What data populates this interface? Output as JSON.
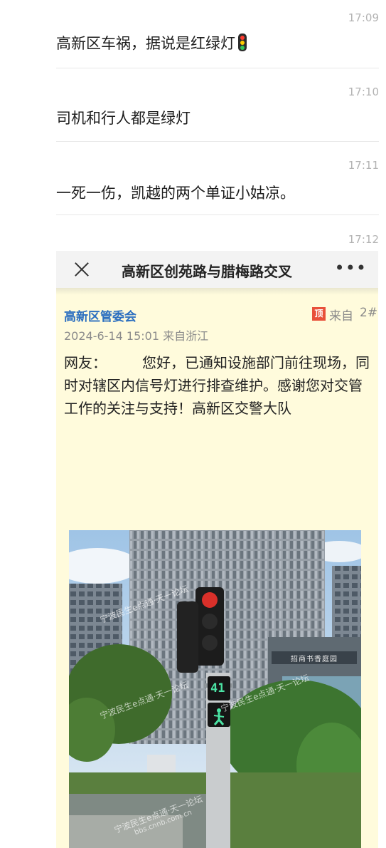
{
  "messages": [
    {
      "time": "17:09",
      "text": "高新区车祸，据说是红绿灯"
    },
    {
      "time": "17:10",
      "text": "司机和行人都是绿灯"
    },
    {
      "time": "17:11",
      "text": "一死一伤，凯越的两个单证小姑凉。"
    }
  ],
  "last_time": "17:12",
  "card": {
    "title": "高新区创苑路与腊梅路交叉",
    "poster": "高新区管委会",
    "badge": "顶",
    "source_label": "来自",
    "floor": "2#",
    "meta": "2024-6-14 15:01 来自浙江",
    "body": "网友：　　　您好，已通知设施部门前往现场，同时对辖区内信号灯进行排查维护。感谢您对交管工作的关注与支持！高新区交警大队",
    "watermark": "宁波民生e点通·天一论坛",
    "watermark_url": "bbs.cnnb.com.cn",
    "signal_countdown": "41",
    "sign_text": "招商书香庭园"
  },
  "icons": [
    "traffic-light-emoji",
    "close-icon",
    "more-icon"
  ]
}
